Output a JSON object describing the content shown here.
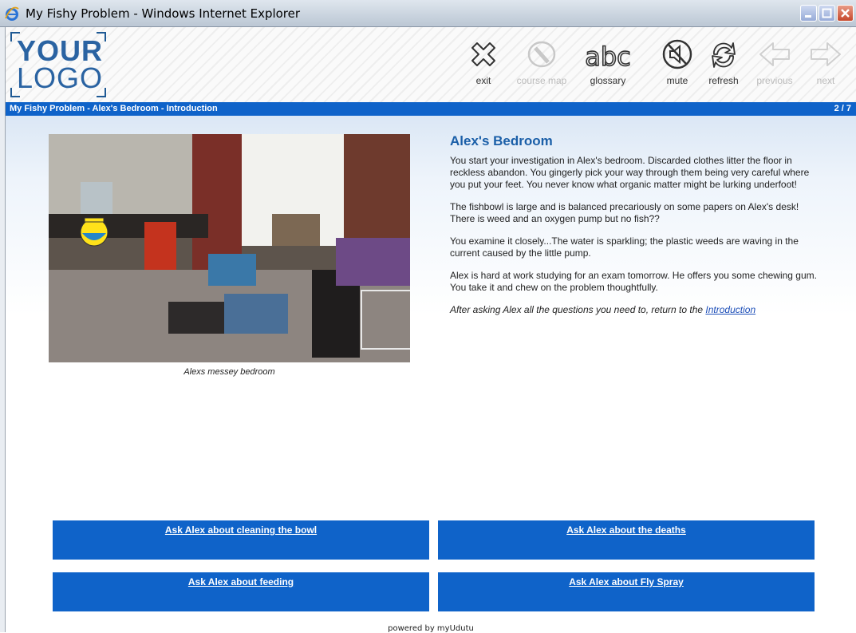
{
  "window": {
    "title": "My Fishy Problem - Windows Internet Explorer"
  },
  "logo": {
    "line1": "YOUR",
    "line2": "LOGO"
  },
  "toolbar": {
    "exit": "exit",
    "course_map": "course map",
    "glossary": "glossary",
    "mute": "mute",
    "refresh": "refresh",
    "previous": "previous",
    "next": "next"
  },
  "breadcrumb": {
    "text": "My Fishy Problem - Alex's Bedroom - Introduction",
    "page_indicator": "2 / 7"
  },
  "main": {
    "heading": "Alex's Bedroom",
    "paragraphs": [
      "You start your investigation in Alex's bedroom.  Discarded clothes litter the floor in reckless abandon.  You gingerly pick your way through them being very careful where you put your feet.  You never know what organic matter might be lurking underfoot!",
      "The fishbowl is large and is balanced precariously on some papers on Alex's desk!  There is weed and an oxygen pump but no fish??",
      "You examine it closely...The water is sparkling; the plastic weeds are waving in the current caused by the little pump.",
      "Alex is hard at work studying for an exam tomorrow.  He offers you some chewing gum.  You take it and chew on the problem thoughtfully."
    ],
    "return_prefix": "After asking Alex all the questions you need to, return to the ",
    "return_link": "Introduction",
    "image_caption": "Alexs messey bedroom"
  },
  "questions": [
    "Ask Alex about cleaning the bowl",
    "Ask Alex about the deaths",
    "Ask Alex about feeding",
    "Ask Alex about Fly Spray"
  ],
  "footer": {
    "powered": "powered by myUdutu"
  },
  "colors": {
    "accent": "#0f63c9",
    "heading": "#1b5fa8",
    "logo": "#2a63a2"
  }
}
